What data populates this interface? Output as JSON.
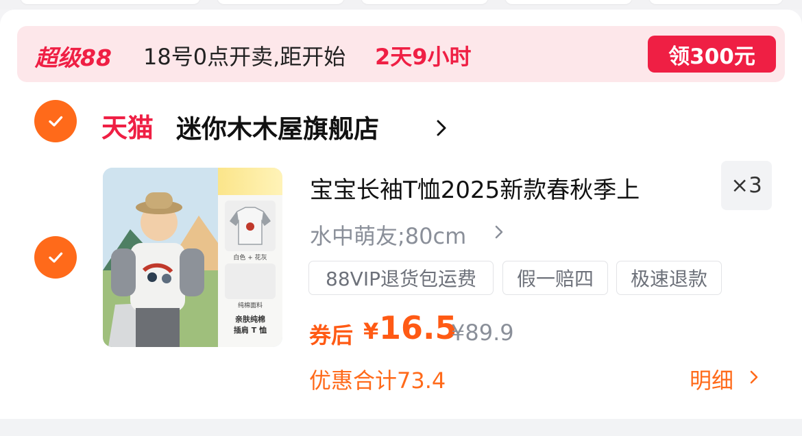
{
  "colors": {
    "accent_red": "#ef1f44",
    "accent_orange": "#ff6a1a",
    "promo_bg": "#fde7ea",
    "muted_text": "#8a8f99"
  },
  "promo": {
    "brand": "超级88",
    "text": "18号0点开卖,距开始",
    "countdown": "2天9小时",
    "coupon_button": "领300元"
  },
  "store": {
    "checkbox_icon": "check-icon",
    "platform": "天猫",
    "name": "迷你木木屋旗舰店",
    "chevron_icon": "chevron-right-icon"
  },
  "product": {
    "checkbox_icon": "check-icon",
    "title": "宝宝长袖T恤2025新款春秋季上",
    "quantity": "×3",
    "sku": "水中萌友;80cm",
    "tags": [
      "88VIP退货包运费",
      "假一赔四",
      "极速退款"
    ],
    "price_label": "券后",
    "price_symbol": "¥",
    "price": "16.5",
    "original_price": "¥89.9",
    "discount_total": "优惠合计73.4",
    "details_label": "明细",
    "image": {
      "swatch1_label": "白色 + 花灰",
      "swatch2_label": "纯棉面料",
      "caption_line1": "亲肤纯棉",
      "caption_line2": "插肩 T 恤"
    }
  }
}
